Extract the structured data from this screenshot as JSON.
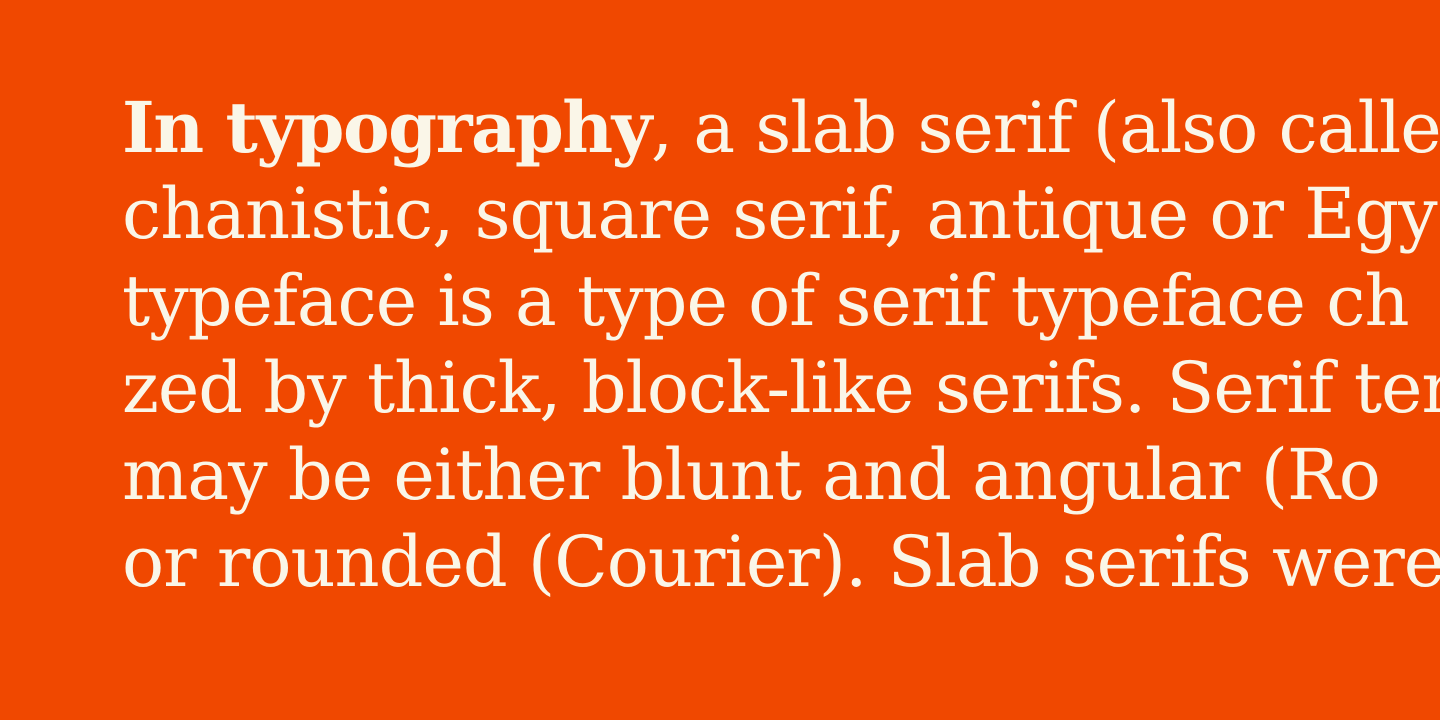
{
  "specimen": {
    "lead_bold": "In typography",
    "lines": [
      ", a slab serif (also calle",
      "chanistic, square serif, antique or Egy",
      "typeface is a type of serif typeface ch",
      "zed by thick, block-like serifs. Serif ter",
      "may be either blunt and angular (Ro",
      "or rounded (Courier). Slab serifs were"
    ]
  },
  "colors": {
    "background": "#F04800",
    "text": "#FAF6E8"
  }
}
